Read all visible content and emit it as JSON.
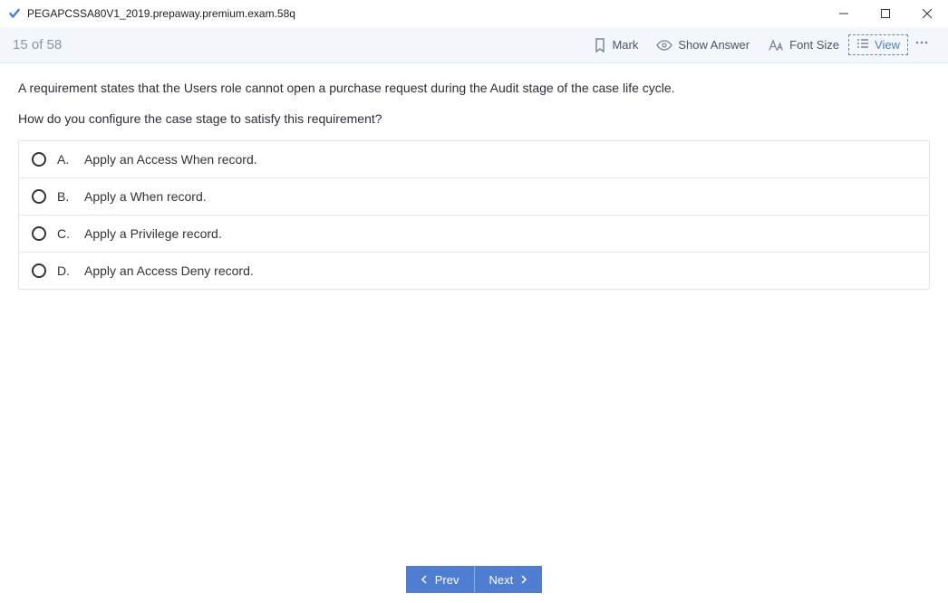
{
  "window": {
    "title": "PEGAPCSSA80V1_2019.prepaway.premium.exam.58q"
  },
  "toolbar": {
    "page_indicator": "15 of 58",
    "mark_label": "Mark",
    "show_answer_label": "Show Answer",
    "font_size_label": "Font Size",
    "view_label": "View"
  },
  "question": {
    "line1": "A requirement states that the Users role cannot open a purchase request during the Audit stage of the case life cycle.",
    "line2": "How do you configure the case stage to satisfy this requirement?"
  },
  "options": [
    {
      "letter": "A.",
      "text": "Apply an Access When record."
    },
    {
      "letter": "B.",
      "text": "Apply a When record."
    },
    {
      "letter": "C.",
      "text": "Apply a Privilege record."
    },
    {
      "letter": "D.",
      "text": "Apply an Access Deny record."
    }
  ],
  "footer": {
    "prev_label": "Prev",
    "next_label": "Next"
  }
}
